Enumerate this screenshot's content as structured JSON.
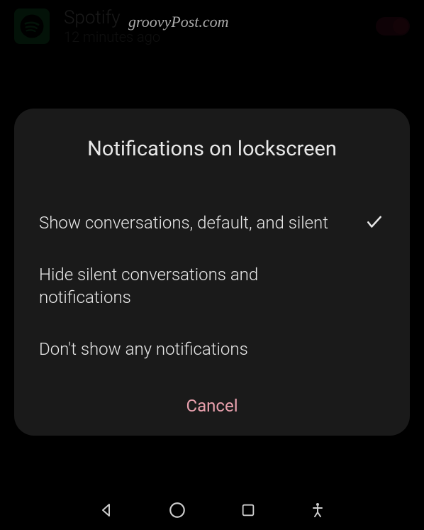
{
  "background": {
    "app_name": "Spotify",
    "timestamp": "12 minutes ago"
  },
  "watermark": "groovyPost.com",
  "dialog": {
    "title": "Notifications on lockscreen",
    "options": [
      {
        "label": "Show conversations, default, and silent",
        "selected": true
      },
      {
        "label": "Hide silent conversations and notifications",
        "selected": false
      },
      {
        "label": "Don't show any notifications",
        "selected": false
      }
    ],
    "cancel_label": "Cancel"
  }
}
